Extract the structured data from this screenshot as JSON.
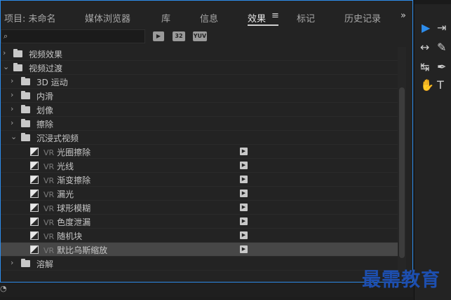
{
  "tabs": [
    {
      "label": "项目: 未命名"
    },
    {
      "label": "媒体浏览器"
    },
    {
      "label": "库"
    },
    {
      "label": "信息"
    },
    {
      "label": "效果"
    },
    {
      "label": "标记"
    },
    {
      "label": "历史记录"
    }
  ],
  "active_tab": "效果",
  "tab_menu_glyph": "≡",
  "overflow_glyph": "»",
  "search": {
    "value": "",
    "placeholder": ""
  },
  "filter_icons": [
    "加速效果",
    "32",
    "YUV"
  ],
  "tree": [
    {
      "label": "视频效果",
      "type": "folder",
      "level": 0,
      "expanded": false
    },
    {
      "label": "视频过渡",
      "type": "folder",
      "level": 0,
      "expanded": true
    },
    {
      "label": "3D 运动",
      "type": "folder",
      "level": 1,
      "expanded": false
    },
    {
      "label": "内滑",
      "type": "folder",
      "level": 1,
      "expanded": false
    },
    {
      "label": "划像",
      "type": "folder",
      "level": 1,
      "expanded": false
    },
    {
      "label": "擦除",
      "type": "folder",
      "level": 1,
      "expanded": false
    },
    {
      "label": "沉浸式视频",
      "type": "folder",
      "level": 1,
      "expanded": true
    },
    {
      "prefix": "VR",
      "label": "光圈擦除",
      "type": "item"
    },
    {
      "prefix": "VR",
      "label": "光线",
      "type": "item"
    },
    {
      "prefix": "VR",
      "label": "渐变擦除",
      "type": "item"
    },
    {
      "prefix": "VR",
      "label": "漏光",
      "type": "item"
    },
    {
      "prefix": "VR",
      "label": "球形模糊",
      "type": "item"
    },
    {
      "prefix": "VR",
      "label": "色度泄漏",
      "type": "item"
    },
    {
      "prefix": "VR",
      "label": "随机块",
      "type": "item"
    },
    {
      "prefix": "VR",
      "label": "默比乌斯缩放",
      "type": "item",
      "selected": true
    },
    {
      "label": "溶解",
      "type": "folder",
      "level": 1,
      "expanded": false
    }
  ],
  "icons": {
    "chevron_right": "›",
    "chevron_down": "⌄",
    "search": "⌕",
    "status": "◔"
  },
  "tools": [
    {
      "name": "selection-tool-icon",
      "glyph": "▶"
    },
    {
      "name": "track-select-tool-icon",
      "glyph": "⇥"
    },
    {
      "name": "ripple-edit-tool-icon",
      "glyph": "↔"
    },
    {
      "name": "razor-tool-icon",
      "glyph": "✎"
    },
    {
      "name": "slip-tool-icon",
      "glyph": "↹"
    },
    {
      "name": "pen-tool-icon",
      "glyph": "✒"
    },
    {
      "name": "hand-tool-icon",
      "glyph": "✋"
    },
    {
      "name": "type-tool-icon",
      "glyph": "T"
    }
  ],
  "colors": {
    "accent": "#2d8ceb",
    "panel_bg": "#232323",
    "selected_row": "#474747",
    "watermark": "#1d4fb0"
  },
  "watermark": "最需教育"
}
